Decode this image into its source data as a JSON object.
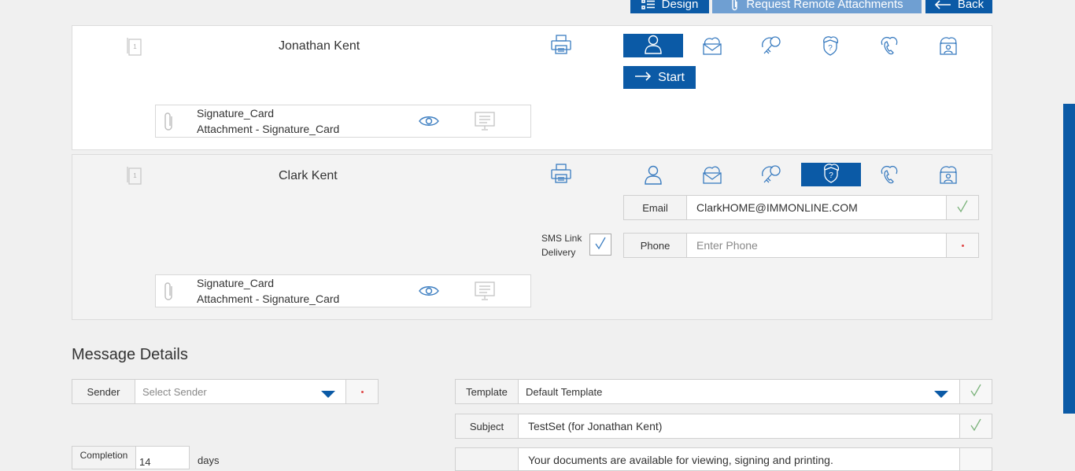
{
  "toolbar": {
    "design_label": "Design",
    "request_label": "Request Remote Attachments",
    "back_label": "Back"
  },
  "signers": [
    {
      "name": "Jonathan Kent",
      "start_label": "Start",
      "attachment": {
        "title": "Signature_Card",
        "subtitle": "Attachment - Signature_Card"
      }
    },
    {
      "name": "Clark Kent",
      "attachment": {
        "title": "Signature_Card",
        "subtitle": "Attachment - Signature_Card"
      },
      "sms": {
        "line1": "SMS Link",
        "line2": "Delivery"
      },
      "email": {
        "label": "Email",
        "value": "ClarkHOME@IMMONLINE.COM"
      },
      "phone": {
        "label": "Phone",
        "placeholder": "Enter Phone"
      }
    }
  ],
  "message": {
    "title": "Message Details",
    "sender": {
      "label": "Sender",
      "placeholder": "Select Sender"
    },
    "template": {
      "label": "Template",
      "value": "Default Template"
    },
    "subject": {
      "label": "Subject",
      "value": "TestSet (for Jonathan Kent)"
    },
    "completion": {
      "label": "Completion",
      "value": "14",
      "unit": "days"
    },
    "body_preview": "Your documents are available for viewing, signing and printing."
  },
  "colors": {
    "accent": "#0b5aa6",
    "accent_light": "#6f9fd2",
    "success": "#7bb37b",
    "error": "#e04848"
  }
}
